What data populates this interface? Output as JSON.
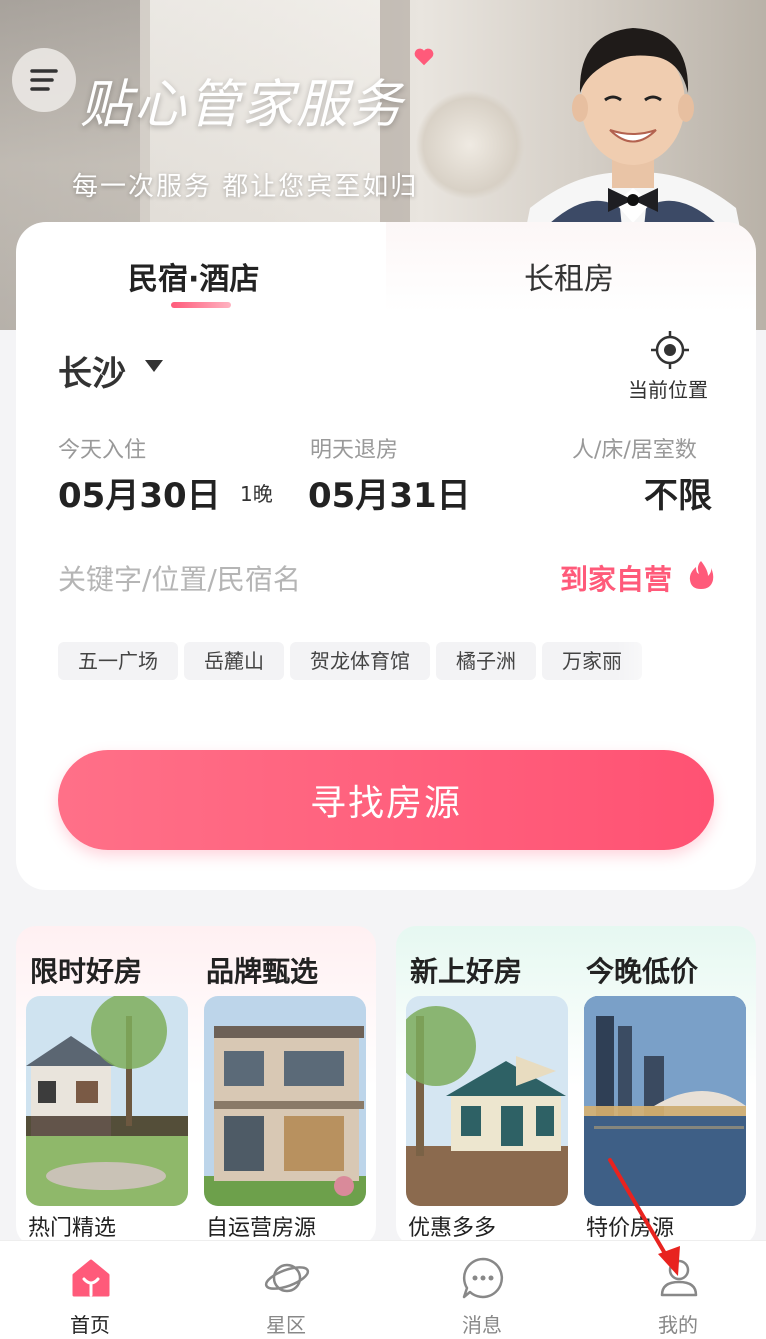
{
  "banner": {
    "slogan": "贴心管家服务",
    "subtitle": "每一次服务 都让您宾至如归"
  },
  "tabs": {
    "stay": "民宿·酒店",
    "long_rent": "长租房"
  },
  "search": {
    "city": "长沙",
    "locate_label": "当前位置",
    "checkin_label": "今天入住",
    "checkin_date": "05月30日",
    "nights": "1晚",
    "checkout_label": "明天退房",
    "checkout_date": "05月31日",
    "guests_label": "人/床/居室数",
    "guests_value": "不限",
    "keyword_placeholder": "关键字/位置/民宿名",
    "self_operated": "到家自营",
    "hot_tags": [
      "五一广场",
      "岳麓山",
      "贺龙体育馆",
      "橘子洲",
      "万家丽"
    ],
    "button": "寻找房源"
  },
  "promos": [
    {
      "title": "限时好房",
      "subtitle": "热门精选"
    },
    {
      "title": "品牌甄选",
      "subtitle": "自运营房源"
    },
    {
      "title": "新上好房",
      "subtitle": "优惠多多"
    },
    {
      "title": "今晚低价",
      "subtitle": "特价房源"
    }
  ],
  "bottom_nav": [
    {
      "label": "首页",
      "icon": "home-icon",
      "active": true
    },
    {
      "label": "星区",
      "icon": "planet-icon",
      "active": false
    },
    {
      "label": "消息",
      "icon": "message-icon",
      "active": false
    },
    {
      "label": "我的",
      "icon": "user-icon",
      "active": false
    }
  ],
  "colors": {
    "accent": "#ff5a7a",
    "button_gradient_start": "#ff7088",
    "button_gradient_end": "#ff5273"
  }
}
